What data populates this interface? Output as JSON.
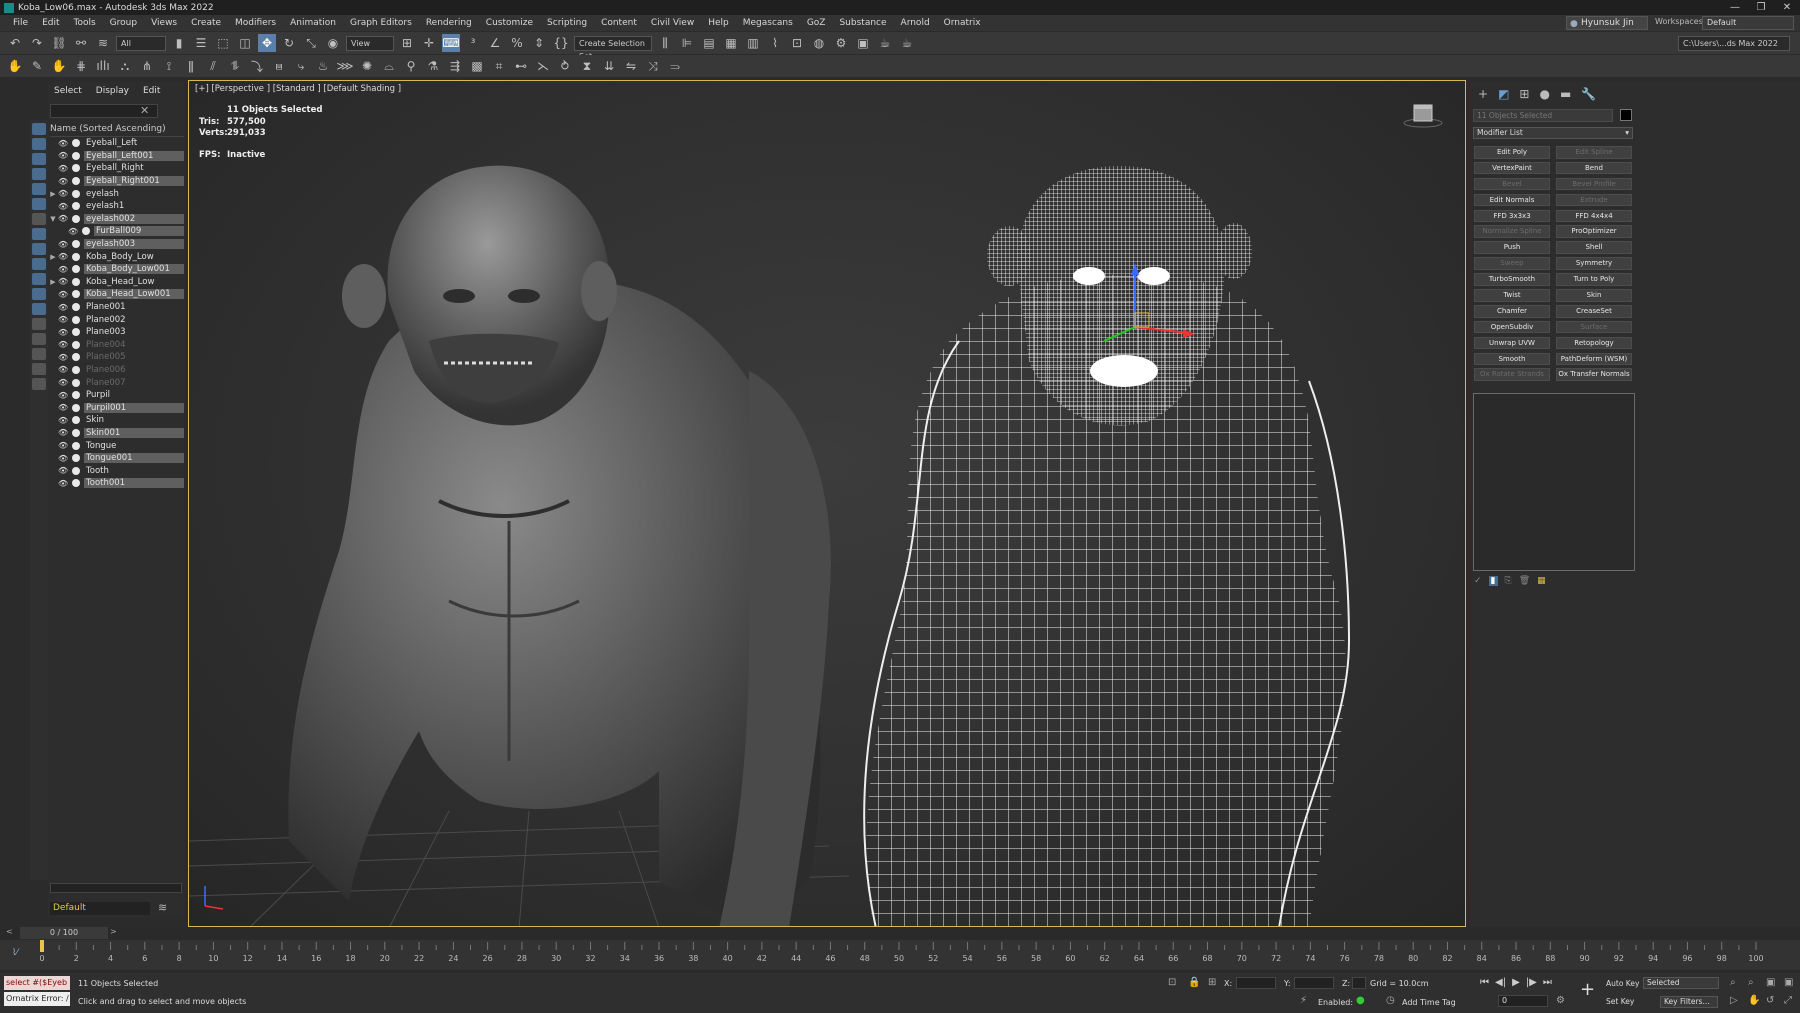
{
  "window": {
    "title": "Koba_Low06.max - Autodesk 3ds Max 2022",
    "controls": [
      "—",
      "❐",
      "✕"
    ]
  },
  "menu": [
    "File",
    "Edit",
    "Tools",
    "Group",
    "Views",
    "Create",
    "Modifiers",
    "Animation",
    "Graph Editors",
    "Rendering",
    "Customize",
    "Scripting",
    "Content",
    "Civil View",
    "Help",
    "Megascans",
    "GoZ",
    "Substance",
    "Arnold",
    "Ornatrix"
  ],
  "user": {
    "name": "Hyunsuk Jin",
    "workspaces_label": "Workspaces:",
    "workspace": "Default"
  },
  "toolbar": {
    "filter": "All",
    "view": "View",
    "selection_set": "Create Selection Set",
    "project_path": "C:\\Users\\...ds Max 2022"
  },
  "scene_explorer": {
    "tabs": [
      "Select",
      "Display",
      "Edit"
    ],
    "header": "Name (Sorted Ascending)",
    "layer": "Default",
    "items": [
      {
        "name": "Eyeball_Left",
        "state": "normal",
        "indent": 0,
        "arrow": ""
      },
      {
        "name": "Eyeball_Left001",
        "state": "sel",
        "indent": 0,
        "arrow": ""
      },
      {
        "name": "Eyeball_Right",
        "state": "normal",
        "indent": 0,
        "arrow": ""
      },
      {
        "name": "Eyeball_Right001",
        "state": "sel",
        "indent": 0,
        "arrow": ""
      },
      {
        "name": "eyelash",
        "state": "normal",
        "indent": 0,
        "arrow": "▶"
      },
      {
        "name": "eyelash1",
        "state": "normal",
        "indent": 0,
        "arrow": ""
      },
      {
        "name": "eyelash002",
        "state": "sel",
        "indent": 0,
        "arrow": "▼"
      },
      {
        "name": "FurBall009",
        "state": "sel",
        "indent": 1,
        "arrow": ""
      },
      {
        "name": "eyelash003",
        "state": "sel",
        "indent": 0,
        "arrow": ""
      },
      {
        "name": "Koba_Body_Low",
        "state": "normal",
        "indent": 0,
        "arrow": "▶"
      },
      {
        "name": "Koba_Body_Low001",
        "state": "sel",
        "indent": 0,
        "arrow": ""
      },
      {
        "name": "Koba_Head_Low",
        "state": "normal",
        "indent": 0,
        "arrow": "▶"
      },
      {
        "name": "Koba_Head_Low001",
        "state": "sel",
        "indent": 0,
        "arrow": ""
      },
      {
        "name": "Plane001",
        "state": "normal",
        "indent": 0,
        "arrow": ""
      },
      {
        "name": "Plane002",
        "state": "normal",
        "indent": 0,
        "arrow": ""
      },
      {
        "name": "Plane003",
        "state": "normal",
        "indent": 0,
        "arrow": ""
      },
      {
        "name": "Plane004",
        "state": "dim",
        "indent": 0,
        "arrow": ""
      },
      {
        "name": "Plane005",
        "state": "dim",
        "indent": 0,
        "arrow": ""
      },
      {
        "name": "Plane006",
        "state": "dim",
        "indent": 0,
        "arrow": ""
      },
      {
        "name": "Plane007",
        "state": "dim",
        "indent": 0,
        "arrow": ""
      },
      {
        "name": "Purpil",
        "state": "normal",
        "indent": 0,
        "arrow": ""
      },
      {
        "name": "Purpil001",
        "state": "sel",
        "indent": 0,
        "arrow": ""
      },
      {
        "name": "Skin",
        "state": "normal",
        "indent": 0,
        "arrow": ""
      },
      {
        "name": "Skin001",
        "state": "sel",
        "indent": 0,
        "arrow": ""
      },
      {
        "name": "Tongue",
        "state": "normal",
        "indent": 0,
        "arrow": ""
      },
      {
        "name": "Tongue001",
        "state": "sel",
        "indent": 0,
        "arrow": ""
      },
      {
        "name": "Tooth",
        "state": "normal",
        "indent": 0,
        "arrow": ""
      },
      {
        "name": "Tooth001",
        "state": "sel",
        "indent": 0,
        "arrow": ""
      }
    ]
  },
  "viewport": {
    "label": "[+] [Perspective ] [Standard ] [Default Shading ]",
    "stats_title": "11 Objects Selected",
    "tris_label": "Tris:",
    "tris": "577,500",
    "verts_label": "Verts:",
    "verts": "291,033",
    "fps_label": "FPS:",
    "fps": "Inactive"
  },
  "command_panel": {
    "object_name": "11 Objects Selected",
    "object_color": "#000000",
    "modifier_list": "Modifier List",
    "modifiers": [
      {
        "label": "Edit Poly",
        "on": true
      },
      {
        "label": "Edit Spline",
        "on": false
      },
      {
        "label": "VertexPaint",
        "on": true
      },
      {
        "label": "Bend",
        "on": true
      },
      {
        "label": "Bevel",
        "on": false
      },
      {
        "label": "Bevel Profile",
        "on": false
      },
      {
        "label": "Edit Normals",
        "on": true
      },
      {
        "label": "Extrude",
        "on": false
      },
      {
        "label": "FFD 3x3x3",
        "on": true
      },
      {
        "label": "FFD 4x4x4",
        "on": true
      },
      {
        "label": "Normalize Spline",
        "on": false
      },
      {
        "label": "ProOptimizer",
        "on": true
      },
      {
        "label": "Push",
        "on": true
      },
      {
        "label": "Shell",
        "on": true
      },
      {
        "label": "Sweep",
        "on": false
      },
      {
        "label": "Symmetry",
        "on": true
      },
      {
        "label": "TurboSmooth",
        "on": true
      },
      {
        "label": "Turn to Poly",
        "on": true
      },
      {
        "label": "Twist",
        "on": true
      },
      {
        "label": "Skin",
        "on": true
      },
      {
        "label": "Chamfer",
        "on": true
      },
      {
        "label": "CreaseSet",
        "on": true
      },
      {
        "label": "OpenSubdiv",
        "on": true
      },
      {
        "label": "Surface",
        "on": false
      },
      {
        "label": "Unwrap UVW",
        "on": true
      },
      {
        "label": "Retopology",
        "on": true
      },
      {
        "label": "Smooth",
        "on": true
      },
      {
        "label": "PathDeform (WSM)",
        "on": true
      },
      {
        "label": "Ox Rotate Strands",
        "on": false
      },
      {
        "label": "Ox Transfer Normals",
        "on": true
      }
    ]
  },
  "timeline": {
    "slider": "0 / 100",
    "ticks": [
      0,
      2,
      4,
      6,
      8,
      10,
      12,
      14,
      16,
      18,
      20,
      22,
      24,
      26,
      28,
      30,
      32,
      34,
      36,
      38,
      40,
      42,
      44,
      46,
      48,
      50,
      52,
      54,
      56,
      58,
      60,
      62,
      64,
      66,
      68,
      70,
      72,
      74,
      76,
      78,
      80,
      82,
      84,
      86,
      88,
      90,
      92,
      94,
      96,
      98,
      100
    ]
  },
  "status": {
    "maxscript": "select #($Eyeb",
    "error": "Ornatrix Error: /",
    "selected": "11 Objects Selected",
    "hint": "Click and drag to select and move objects",
    "x_label": "X:",
    "y_label": "Y:",
    "z_label": "Z:",
    "grid": "Grid = 10.0cm",
    "enabled": "Enabled:",
    "add_time_tag": "Add Time Tag",
    "auto_key": "Auto Key",
    "set_key": "Set Key",
    "selected_dropdown": "Selected",
    "key_filters": "Key Filters...",
    "frame": "0"
  }
}
